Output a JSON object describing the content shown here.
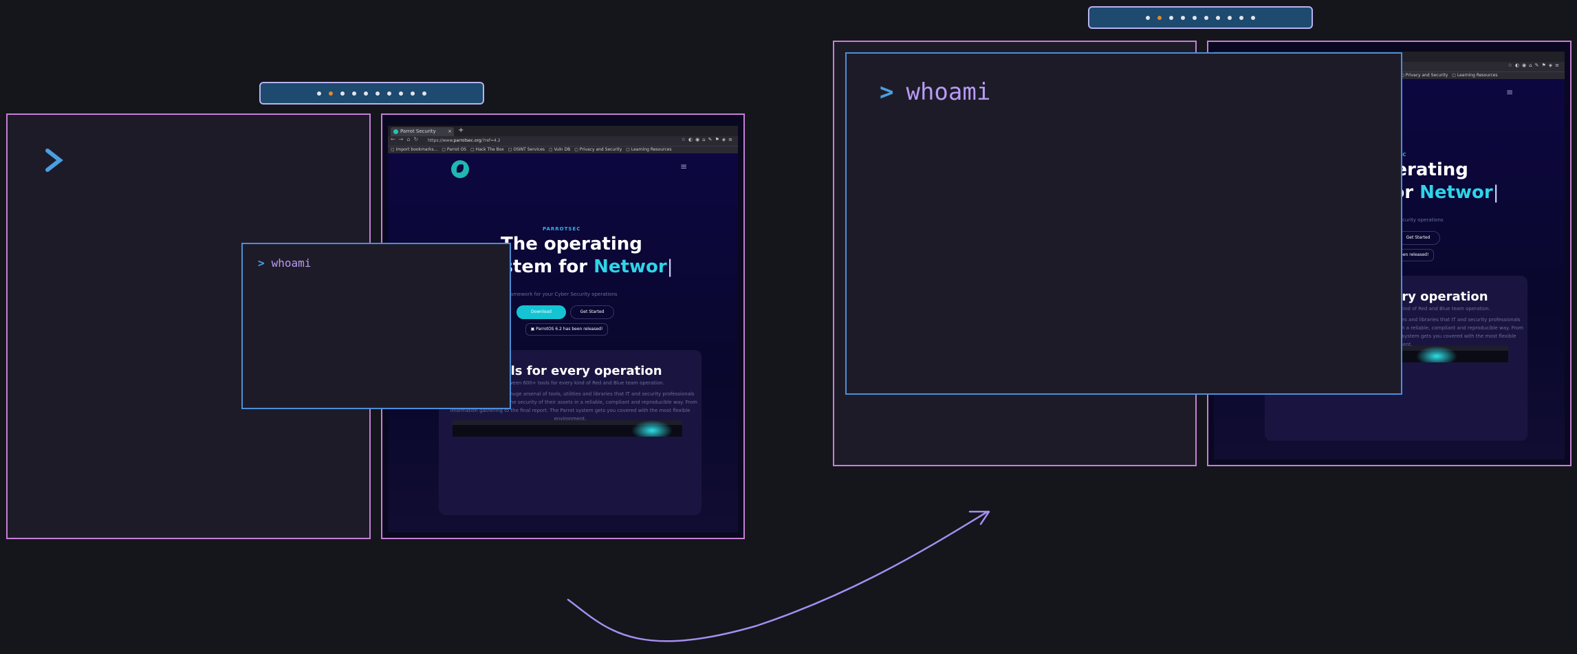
{
  "colors": {
    "background": "#14161b",
    "window_border": "#c77fd6",
    "focused_border": "#4b8fda",
    "window_bg": "#1e1b29",
    "accent_cyan": "#2fd4e8",
    "prompt_blue": "#4a9fe0",
    "command_purple": "#b79cf2",
    "ws_active": "#e08a2e"
  },
  "workspaces_left": {
    "count": 10,
    "active_index": 1
  },
  "workspaces_right": {
    "count": 10,
    "active_index": 1
  },
  "terminal": {
    "prompt_icon": "chevron-right-icon",
    "prompt_symbol": ">",
    "command": "whoami"
  },
  "browser": {
    "tab_title": "Parrot Security",
    "tab_close": "×",
    "new_tab": "+",
    "url_prefix": "https://www.",
    "url_domain": "parrotsec.org",
    "url_suffix": "/?ref=4.2",
    "bookmarks": [
      "Import bookmarks...",
      "Parrot OS",
      "Hack The Box",
      "OSINT Services",
      "Vuln DB",
      "Privacy and Security",
      "Learning Resources"
    ],
    "page": {
      "eyebrow": "PARROTSEC",
      "headline_line1": "The operating",
      "headline_line2_prefix": "system for ",
      "headline_highlight": "Networ",
      "subtitle": "The ultimate framework for your Cyber Security operations",
      "download_label": "Download",
      "get_started_label": "Get Started",
      "news_label": "ParrotOS 6.2 has been released!",
      "card_title": "Tools for every operation",
      "card_subtitle": "Choose between 600+ tools for every kind of Red and Blue team operation.",
      "card_body": "Parrot Security provides a huge arsenal of tools, utilities and libraries that IT and security professionals can use to test and assess the security of their assets in a reliable, compliant and reproducible way. From information gathering to the final report. The Parrot system gets you covered with the most flexible environment."
    }
  }
}
